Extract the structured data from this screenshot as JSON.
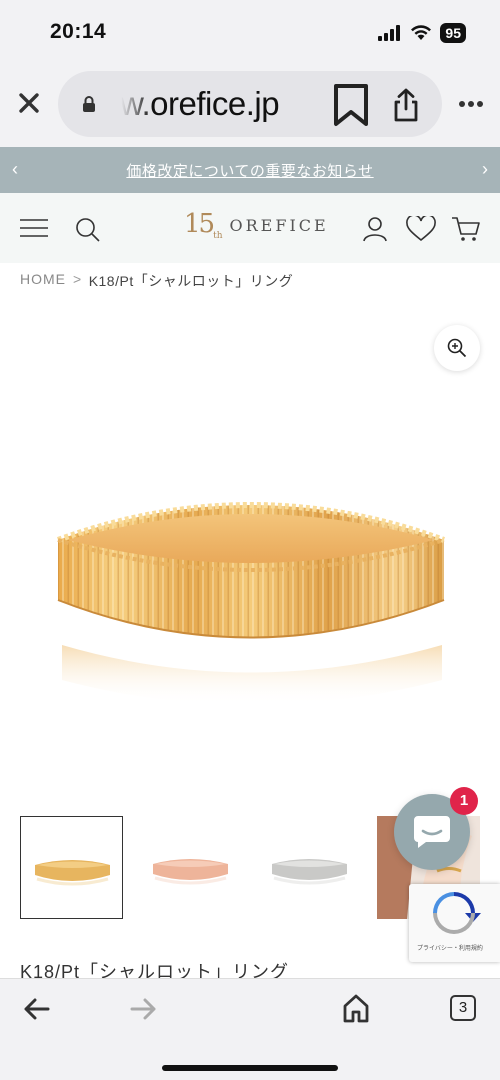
{
  "status_bar": {
    "time": "20:14",
    "battery": "95"
  },
  "browser": {
    "url": "w.orefice.jp",
    "tab_count": "3"
  },
  "announcement": {
    "text": "価格改定についての重要なお知らせ"
  },
  "header": {
    "logo_number": "15",
    "logo_sub": "th",
    "logo_name": "OREFICE"
  },
  "breadcrumb": {
    "home": "HOME",
    "separator": ">",
    "current": "K18/Pt「シャルロット」リング"
  },
  "product": {
    "title": "K18/Pt「シャルロット」リング",
    "colors": {
      "gold": "#e7b55f",
      "rose": "#eeb49a",
      "platinum": "#c9c9c7"
    }
  },
  "chat": {
    "badge_count": "1",
    "accent": "#95a8ad"
  },
  "recaptcha": {
    "text": "プライバシー・利用規約"
  },
  "icons": {
    "close": "close-icon",
    "lock": "lock-icon",
    "bookmark": "bookmark-icon",
    "share": "share-icon",
    "more": "more-icon",
    "menu": "hamburger-menu-icon",
    "search": "search-icon",
    "account": "user-icon",
    "wishlist": "heart-icon",
    "cart": "cart-icon",
    "zoom": "zoom-in-icon",
    "chat": "chat-icon",
    "back": "arrow-left-icon",
    "forward": "arrow-right-icon",
    "home": "home-icon"
  }
}
